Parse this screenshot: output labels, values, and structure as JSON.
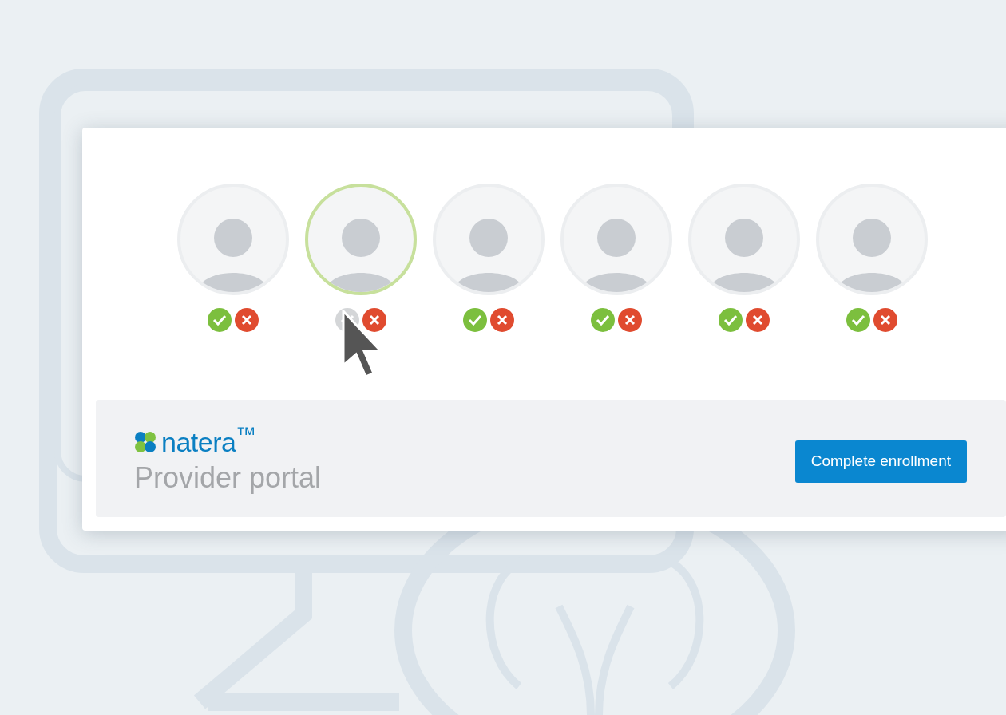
{
  "people": [
    {
      "selected": false,
      "approved": true
    },
    {
      "selected": true,
      "approved": false
    },
    {
      "selected": false,
      "approved": true
    },
    {
      "selected": false,
      "approved": true
    },
    {
      "selected": false,
      "approved": true
    },
    {
      "selected": false,
      "approved": true
    }
  ],
  "logo": {
    "text": "natera",
    "mark": "™"
  },
  "title": "Provider portal",
  "button": "Complete enrollment"
}
